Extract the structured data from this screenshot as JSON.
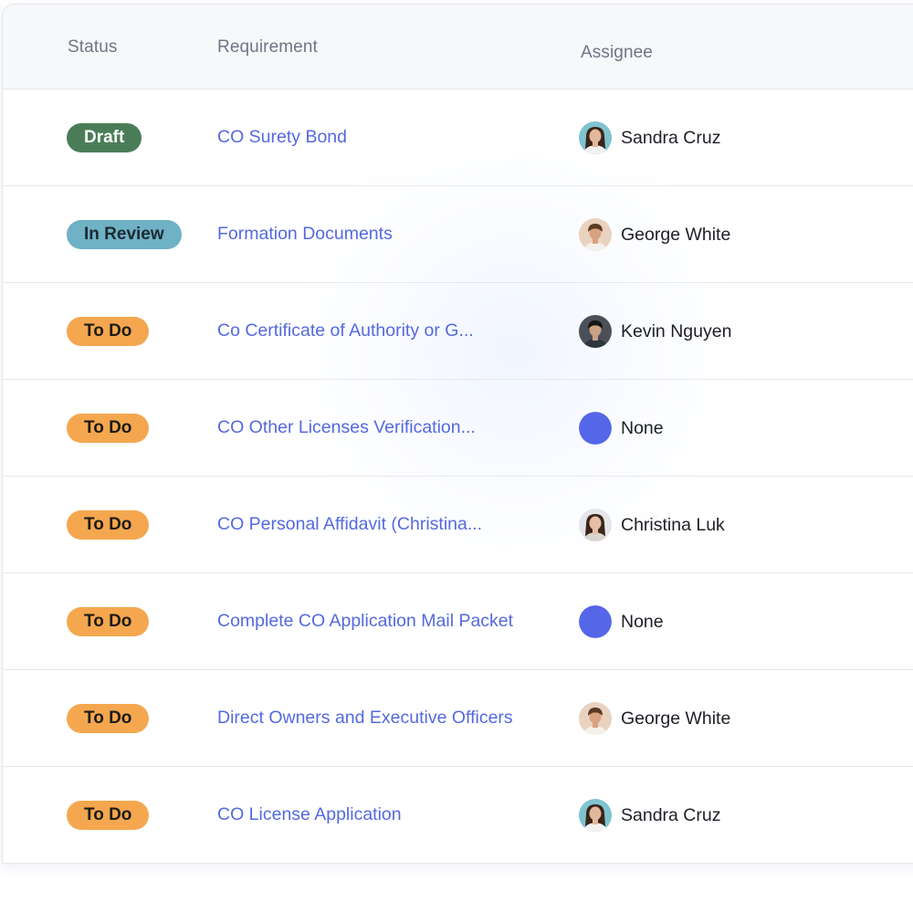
{
  "table": {
    "headers": {
      "status": "Status",
      "requirement": "Requirement",
      "assignee": "Assignee"
    },
    "status_colors": {
      "Draft": {
        "bg": "#4a7d57",
        "fg": "#ffffff"
      },
      "In Review": {
        "bg": "#6fb1c5",
        "fg": "#1c2a33"
      },
      "To Do": {
        "bg": "#f4a74f",
        "fg": "#1d1b16"
      }
    },
    "rows": [
      {
        "status": "Draft",
        "requirement": "CO Surety Bond",
        "assignee": "Sandra Cruz",
        "avatar": "sandra-avatar"
      },
      {
        "status": "In Review",
        "requirement": "Formation Documents",
        "assignee": "George White",
        "avatar": "george-avatar"
      },
      {
        "status": "To Do",
        "requirement": "Co Certificate of Authority or G...",
        "assignee": "Kevin Nguyen",
        "avatar": "kevin-avatar"
      },
      {
        "status": "To Do",
        "requirement": "CO Other Licenses Verification...",
        "assignee": "None",
        "avatar": "none-avatar"
      },
      {
        "status": "To Do",
        "requirement": "CO Personal Affidavit (Christina...",
        "assignee": "Christina Luk",
        "avatar": "christina-avatar"
      },
      {
        "status": "To Do",
        "requirement": "Complete CO Application Mail Packet",
        "assignee": "None",
        "avatar": "none-avatar"
      },
      {
        "status": "To Do",
        "requirement": "Direct Owners and Executive Officers",
        "assignee": "George White",
        "avatar": "george-avatar"
      },
      {
        "status": "To Do",
        "requirement": "CO License Application",
        "assignee": "Sandra Cruz",
        "avatar": "sandra-avatar"
      }
    ]
  },
  "colors": {
    "link": "#5469e0",
    "none_avatar": "#5566e8"
  }
}
